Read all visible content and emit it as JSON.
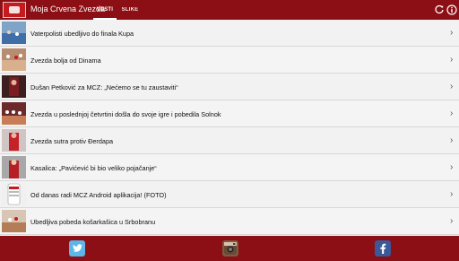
{
  "header": {
    "app_title": "Moja Crvena Zvezda",
    "tabs": [
      {
        "label": "VESTI",
        "selected": true
      },
      {
        "label": "SLIKE",
        "selected": false
      }
    ],
    "icons": [
      "refresh-icon",
      "info-icon"
    ]
  },
  "news": [
    {
      "title": "Vaterpolisti ubedljivo do finala Kupa"
    },
    {
      "title": "Zvezda bolja od Dinama"
    },
    {
      "title": "Dušan Petković za MCZ: „Nećemo se tu zaustaviti“"
    },
    {
      "title": "Zvezda u poslednjoj četvrtini došla do svoje igre i pobedila Solnok"
    },
    {
      "title": "Zvezda sutra protiv Đerdapa"
    },
    {
      "title": "Kasalica: „Pavićević bi bio veliko pojačanje“"
    },
    {
      "title": "Od danas radi MCZ Android aplikacija! (FOTO)"
    },
    {
      "title": "Ubedljiva pobeda košarkašica u Srbobranu"
    }
  ],
  "footer": {
    "social": [
      "twitter-icon",
      "instagram-icon",
      "facebook-icon"
    ]
  },
  "colors": {
    "brand": "#8b0f14",
    "list_bg": "#f3f3f3",
    "text": "#111111"
  }
}
